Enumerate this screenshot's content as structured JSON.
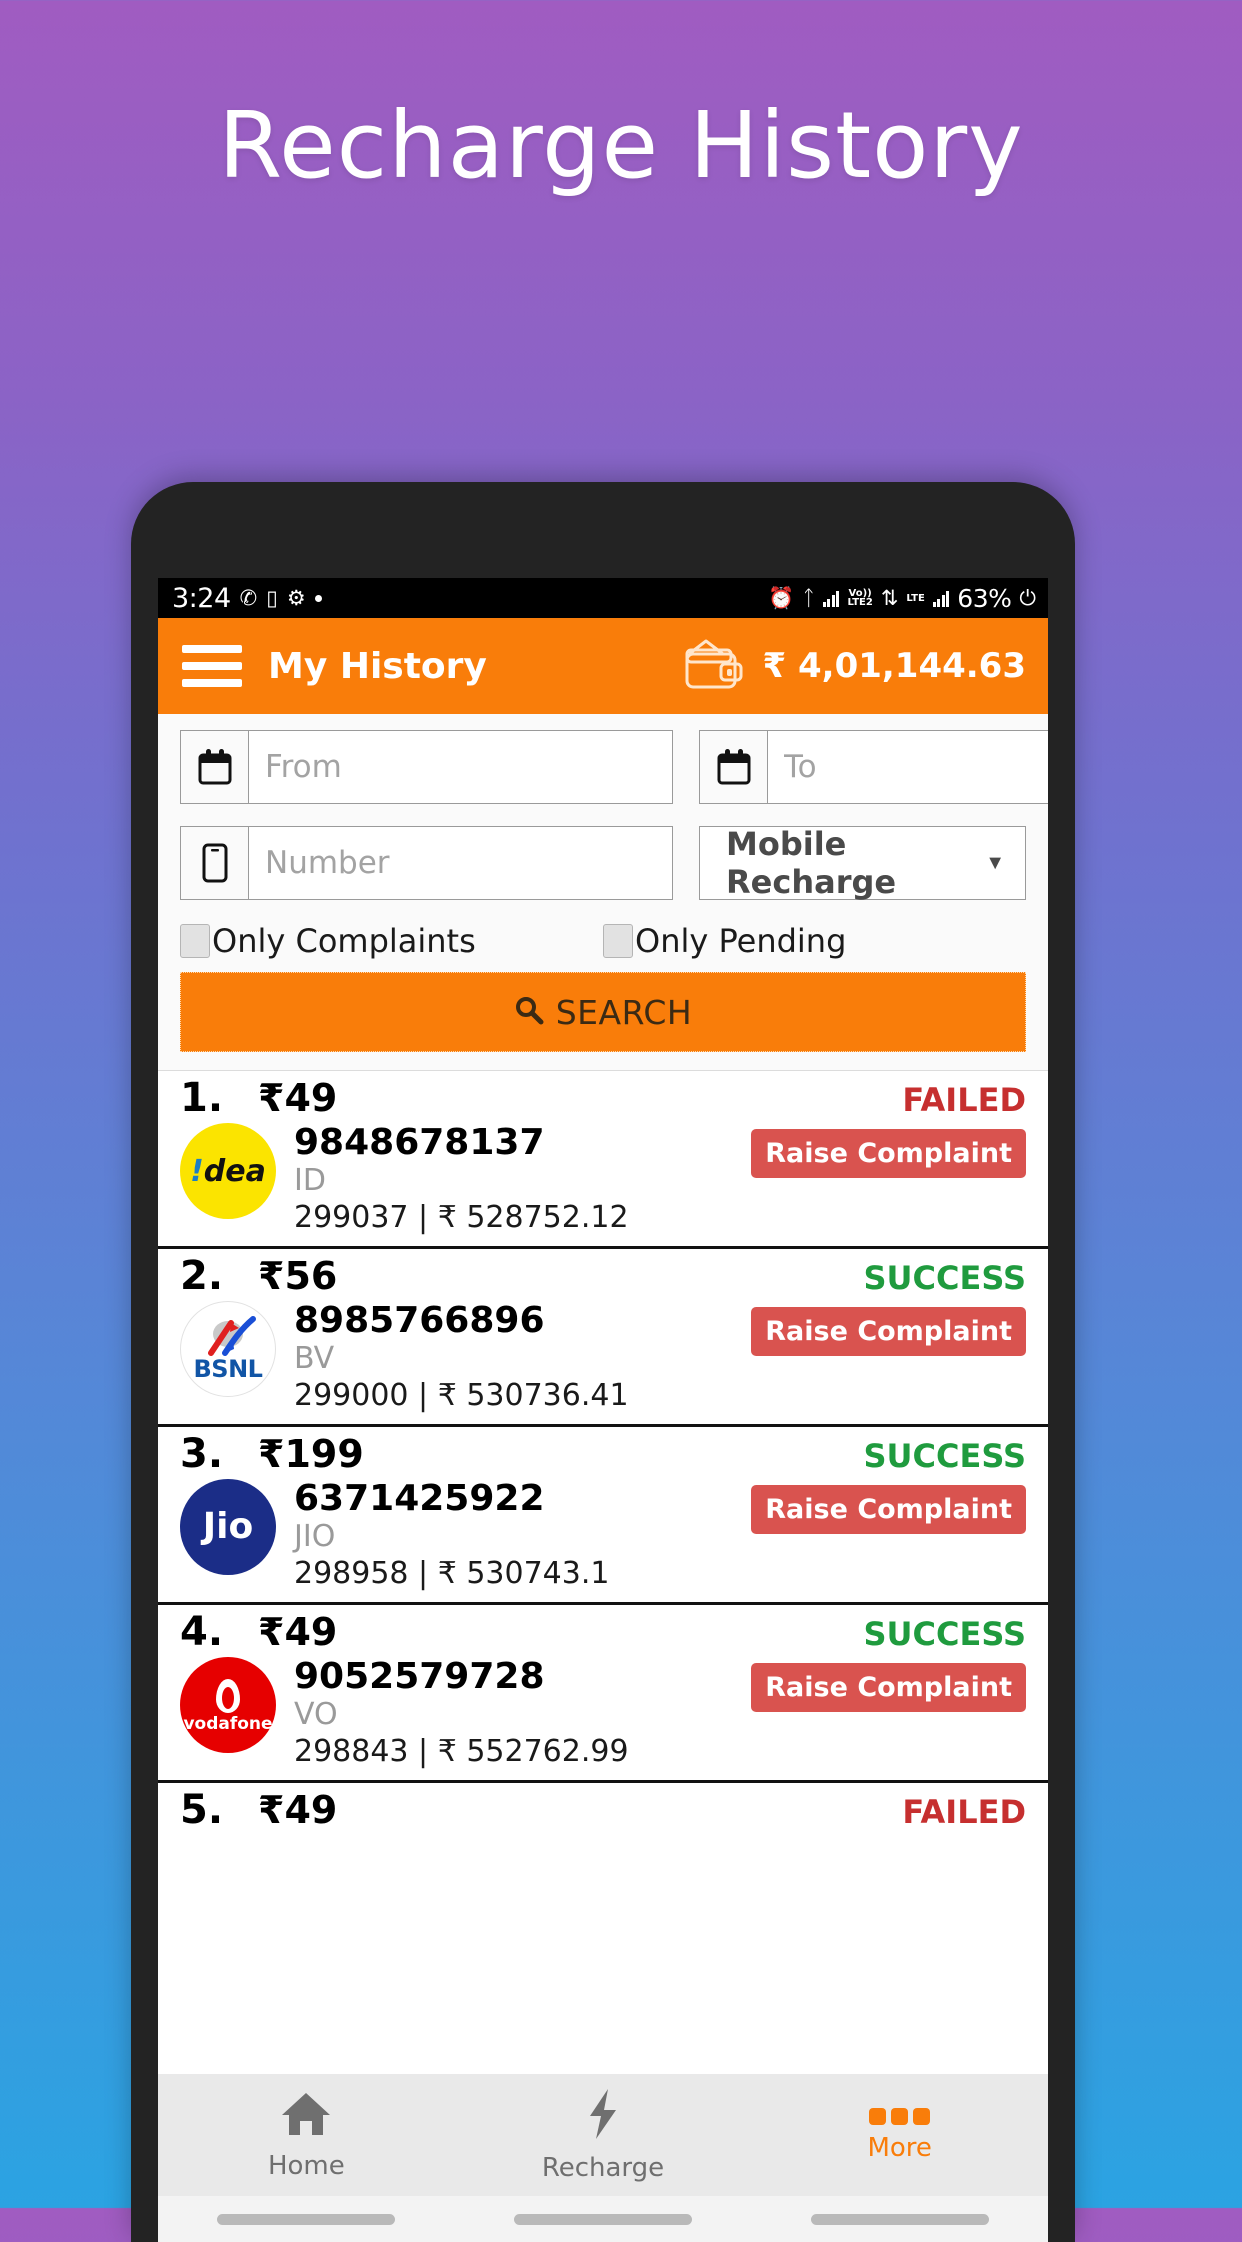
{
  "promo": {
    "title": "Recharge History"
  },
  "theme": {
    "accent": "#f97d0a",
    "success": "#1f9b3e",
    "failed": "#c62f2f",
    "complaint": "#d9534f"
  },
  "status_bar": {
    "time": "3:24",
    "left_icons": [
      "whatsapp-icon",
      "screencast-icon",
      "do-not-disturb-icon",
      "dot-icon"
    ],
    "right_icons": [
      "alarm-icon",
      "bluetooth-icon",
      "signal-lte2-icon",
      "volte-icon",
      "lte-icon",
      "signal-icon"
    ],
    "volte_label": "Vo))",
    "lte2_label": "LTE2",
    "lte_label": "LTE",
    "battery": "63%"
  },
  "appbar": {
    "menu_icon": "hamburger-menu-icon",
    "title": "My History",
    "wallet_icon": "wallet-icon",
    "balance": "₹ 4,01,144.63"
  },
  "filters": {
    "from": {
      "icon": "calendar-icon",
      "placeholder": "From",
      "value": ""
    },
    "to": {
      "icon": "calendar-icon",
      "placeholder": "To",
      "value": ""
    },
    "number": {
      "icon": "mobile-phone-icon",
      "placeholder": "Number",
      "value": ""
    },
    "service": {
      "selected": "Mobile Recharge",
      "caret": "▼"
    },
    "only_complaints": {
      "label": "Only Complaints",
      "checked": false
    },
    "only_pending": {
      "label": "Only Pending",
      "checked": false
    },
    "search_button": {
      "icon": "search-icon",
      "label": "SEARCH"
    }
  },
  "transactions": [
    {
      "index": "1.",
      "amount": "₹49",
      "status": "FAILED",
      "logo": "idea-logo",
      "number": "9848678137",
      "operator": "ID",
      "reference": "299037 | ₹ 528752.12",
      "action_label": "Raise Complaint"
    },
    {
      "index": "2.",
      "amount": "₹56",
      "status": "SUCCESS",
      "logo": "bsnl-logo",
      "number": "8985766896",
      "operator": "BV",
      "reference": "299000 | ₹ 530736.41",
      "action_label": "Raise Complaint"
    },
    {
      "index": "3.",
      "amount": "₹199",
      "status": "SUCCESS",
      "logo": "jio-logo",
      "number": "6371425922",
      "operator": "JIO",
      "reference": "298958 | ₹ 530743.1",
      "action_label": "Raise Complaint"
    },
    {
      "index": "4.",
      "amount": "₹49",
      "status": "SUCCESS",
      "logo": "vodafone-logo",
      "number": "9052579728",
      "operator": "VO",
      "reference": "298843 | ₹ 552762.99",
      "action_label": "Raise Complaint"
    },
    {
      "index": "5.",
      "amount": "₹49",
      "status": "FAILED",
      "logo": "",
      "number": "",
      "operator": "",
      "reference": "",
      "action_label": ""
    }
  ],
  "bottom_nav": [
    {
      "icon": "home-icon",
      "label": "Home",
      "active": false
    },
    {
      "icon": "lightning-bolt-icon",
      "label": "Recharge",
      "active": false
    },
    {
      "icon": "more-dots-icon",
      "label": "More",
      "active": true
    }
  ]
}
